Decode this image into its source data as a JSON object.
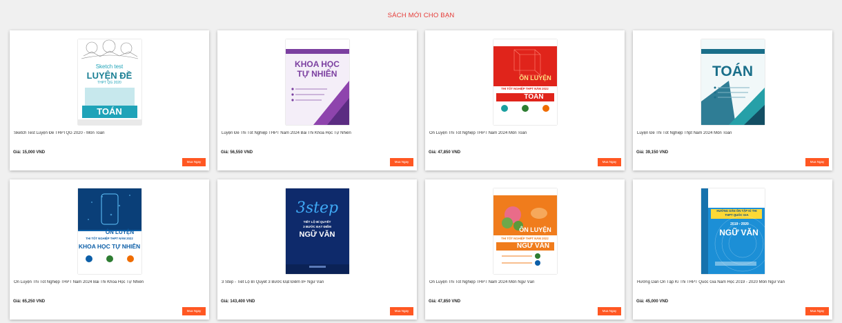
{
  "section": {
    "title": "SÁCH MỚI CHO BẠN"
  },
  "buy_label": "Mua Ngay",
  "products": [
    {
      "name": "Sketch Test Luyện Đề THPTQG 2020 - Môn Toán",
      "price": "Giá: 15,000 VND",
      "cover": {
        "theme": "sketch",
        "accent": "#1fa3b8",
        "title_lines": [
          "Sketch test",
          "LUYỆN ĐỀ",
          "THPT QG 2020",
          "TOÁN"
        ]
      }
    },
    {
      "name": "Luyện Đề Thi Tốt Nghiệp THPT Năm 2024 Bài Thi Khoa Học Tự Nhiên",
      "price": "Giá: 56,550 VND",
      "cover": {
        "theme": "purple",
        "accent": "#7b3fa0",
        "title_lines": [
          "KHOA HỌC",
          "TỰ NHIÊN"
        ]
      }
    },
    {
      "name": "Ôn Luyện Thi Tốt Nghiệp THPT Năm 2024 Môn Toán",
      "price": "Giá: 47,850 VND",
      "cover": {
        "theme": "red",
        "accent": "#e0241b",
        "title_lines": [
          "ÔN LUYỆN",
          "THI TỐT NGHIỆP THPT NĂM 2022",
          "TOÁN"
        ]
      }
    },
    {
      "name": "Luyện Đề Thi Tốt Nghiệp Thpt Năm 2024 Môn Toán",
      "price": "Giá: 39,150 VND",
      "cover": {
        "theme": "teal",
        "accent": "#1a6f8a",
        "title_lines": [
          "TOÁN"
        ]
      }
    },
    {
      "name": "Ôn Luyện Thi Tốt Nghiệp THPT Năm 2024 Bài Thi Khoa Học Tự Nhiên",
      "price": "Giá: 65,250 VND",
      "cover": {
        "theme": "blue",
        "accent": "#0d5fa8",
        "title_lines": [
          "ÔN LUYỆN",
          "THI TỐT NGHIỆP THPT NĂM 2022",
          "KHOA HỌC TỰ NHIÊN"
        ]
      }
    },
    {
      "name": "3 Step - Tiết Lộ Bí Quyết 3 Bước Đạt Điểm 8+ Ngữ Văn",
      "price": "Giá: 143,400 VND",
      "cover": {
        "theme": "navy",
        "accent": "#0e2a6b",
        "title_lines": [
          "3step",
          "TIẾT LỘ BÍ QUYẾT",
          "3 BƯỚC ĐẠT ĐIỂM",
          "NGỮ VĂN"
        ]
      }
    },
    {
      "name": "Ôn Luyện Thi Tốt Nghiệp THPT Năm 2024 Môn Ngữ Văn",
      "price": "Giá: 47,850 VND",
      "cover": {
        "theme": "orange",
        "accent": "#f07c1c",
        "title_lines": [
          "ÔN LUYỆN",
          "THI TỐT NGHIỆP THPT NĂM 2022",
          "NGỮ VĂN"
        ]
      }
    },
    {
      "name": "Hướng Dẫn Ôn Tập Kì Thi THPT Quốc Gia Năm Học 2019 - 2020 Môn Ngữ Văn",
      "price": "Giá: 45,000 VND",
      "cover": {
        "theme": "skyblue",
        "accent": "#1c8fd6",
        "title_lines": [
          "HƯỚNG DẪN ÔN TẬP KÌ THI",
          "THPT QUỐC GIA",
          "2019 - 2020",
          "NGỮ VĂN"
        ]
      }
    }
  ]
}
